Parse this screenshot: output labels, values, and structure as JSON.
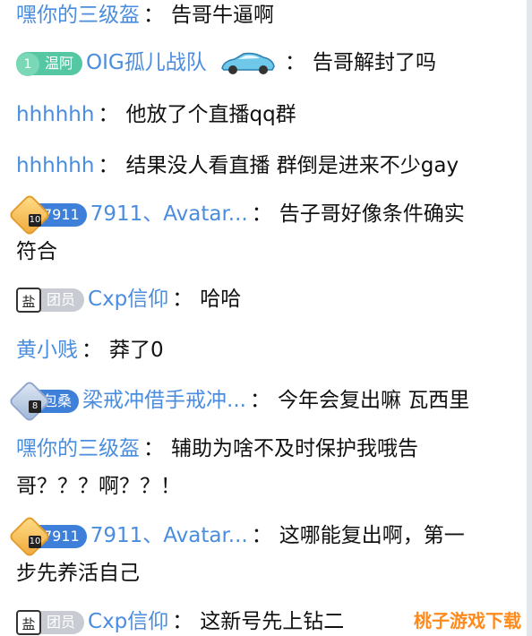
{
  "messages": [
    {
      "name": "嘿你的三级盔",
      "sep": "：",
      "text": "告哥牛逼啊"
    },
    {
      "badge_level": "1",
      "badge_text": "温阿",
      "name": "OIG孤儿战队",
      "sep": "：",
      "text": "告哥解封了吗"
    },
    {
      "name": "hhhhhh",
      "sep": "：",
      "text": "他放了个直播qq群"
    },
    {
      "name": "hhhhhh",
      "sep": "：",
      "text": "结果没人看直播 群倒是进来不少gay"
    },
    {
      "crest_num": "10",
      "badge_text": "7911",
      "name": "7911、Avatar...",
      "sep": "：",
      "text": "告子哥好像条件确实",
      "text2": "符合"
    },
    {
      "fan_char": "盐",
      "badge_text": "团员",
      "name": "Cxp信仰",
      "sep": "：",
      "text": "哈哈"
    },
    {
      "name": "黄小贱",
      "sep": "：",
      "text": "莽了0"
    },
    {
      "crest_num": "8",
      "badge_text": "包桑",
      "name": "梁戒冲借手戒冲...",
      "sep": "：",
      "text": "今年会复出嘛 瓦西里"
    },
    {
      "name": "嘿你的三级盔",
      "sep": "：",
      "text": "辅助为啥不及时保护我哦告",
      "text2": "哥？？？啊？？！"
    },
    {
      "crest_num": "10",
      "badge_text": "7911",
      "name": "7911、Avatar...",
      "sep": "：",
      "text": "这哪能复出啊，第一",
      "text2": "步先养活自己"
    },
    {
      "fan_char": "盐",
      "badge_text": "团员",
      "name": "Cxp信仰",
      "sep": "：",
      "text": "这新号先上钻二"
    }
  ],
  "watermark": "桃子游戏下载",
  "colors": {
    "name": "#4a8dde",
    "green_badge": "#55c7a3",
    "blue_badge": "#3d7fd9",
    "gray_badge": "#c8ccd2",
    "watermark": "#ff8a1c"
  }
}
